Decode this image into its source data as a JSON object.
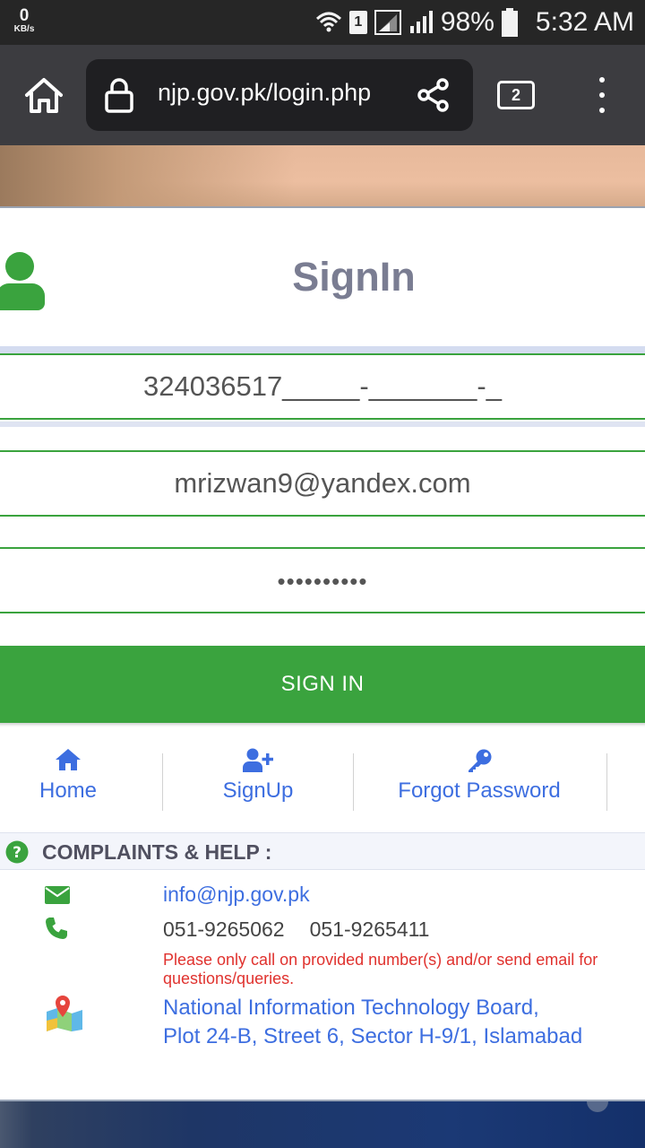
{
  "status_bar": {
    "net_speed": "0",
    "net_unit": "KB/s",
    "sim": "1",
    "battery": "98%",
    "time": "5:32 AM"
  },
  "browser": {
    "url": "njp.gov.pk/login.php",
    "tab_count": "2"
  },
  "signin": {
    "title": "SignIn",
    "cnic_value": "324036517_____-_______-_",
    "email_value": "mrizwan9@yandex.com",
    "password_mask": "••••••••••",
    "button_label": "SIGN IN"
  },
  "links": [
    {
      "label": "Home",
      "icon": "home-icon"
    },
    {
      "label": "SignUp",
      "icon": "user-plus-icon"
    },
    {
      "label": "Forgot Password",
      "icon": "key-icon"
    }
  ],
  "help": {
    "title": "COMPLAINTS & HELP :",
    "email": "info@njp.gov.pk",
    "phone1": "051-9265062",
    "phone2": "051-9265411",
    "warning_line1": "Please only call on provided number(s) and/or send email for",
    "warning_line2": "questions/queries.",
    "address_line1": "National Information Technology Board,",
    "address_line2": "Plot 24-B, Street 6, Sector H-9/1, Islamabad"
  },
  "colors": {
    "accent_green": "#3aa33e",
    "link_blue": "#3d6ee0",
    "warning_red": "#e0322e"
  }
}
